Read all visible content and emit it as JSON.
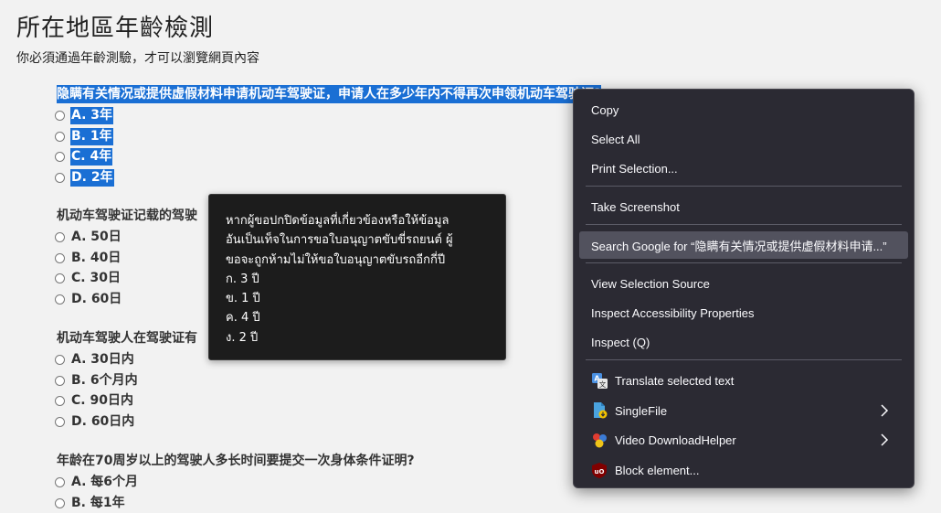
{
  "page": {
    "title": "所在地區年齡檢測",
    "subtitle": "你必須通過年齡測驗，才可以瀏覽網頁內容"
  },
  "questions": [
    {
      "text": "隐瞒有关情况或提供虚假材料申请机动车驾驶证，申请人在多少年内不得再次申领机动车驾驶证?",
      "options": [
        "A. 3年",
        "B. 1年",
        "C. 4年",
        "D. 2年"
      ]
    },
    {
      "text": "机动车驾驶证记载的驾驶",
      "options": [
        "A. 50日",
        "B. 40日",
        "C. 30日",
        "D. 60日"
      ]
    },
    {
      "text": "机动车驾驶人在驾驶证有",
      "options": [
        "A. 30日内",
        "B. 6个月内",
        "C. 90日内",
        "D. 60日内"
      ]
    },
    {
      "text": "年龄在70周岁以上的驾驶人多长时间要提交一次身体条件证明?",
      "options": [
        "A. 每6个月",
        "B. 每1年"
      ]
    }
  ],
  "tooltip": {
    "lines": [
      "หากผู้ขอปกปิดข้อมูลที่เกี่ยวข้องหรือให้ข้อมูล",
      "อันเป็นเท็จในการขอใบอนุญาตขับขี่รถยนต์ ผู้",
      "ขอจะถูกห้ามไม่ให้ขอใบอนุญาตขับรถอีกกี่ปี",
      "ก. 3 ปี",
      "ข. 1 ปี",
      "ค. 4 ปี",
      "ง. 2 ปี"
    ]
  },
  "context_menu": {
    "copy": "Copy",
    "select_all": "Select All",
    "print_selection": "Print Selection...",
    "take_screenshot": "Take Screenshot",
    "search_google": "Search Google for “隐瞒有关情况或提供虚假材料申请...”",
    "view_selection_source": "View Selection Source",
    "inspect_accessibility": "Inspect Accessibility Properties",
    "inspect": "Inspect (Q)",
    "translate": "Translate selected text",
    "singlefile": "SingleFile",
    "video_downloadhelper": "Video DownloadHelper",
    "block_element": "Block element..."
  },
  "icons": {
    "translate": "translate-icon",
    "singlefile": "singlefile-icon",
    "video_downloadhelper": "video-downloadhelper-icon",
    "block_element": "ublock-origin-icon",
    "submenu": "chevron-right-icon"
  },
  "colors": {
    "selection": "#1a6fd4",
    "menu_bg": "#2b2a33",
    "menu_hover": "#52525e",
    "tooltip_bg": "#1c1c1c"
  }
}
